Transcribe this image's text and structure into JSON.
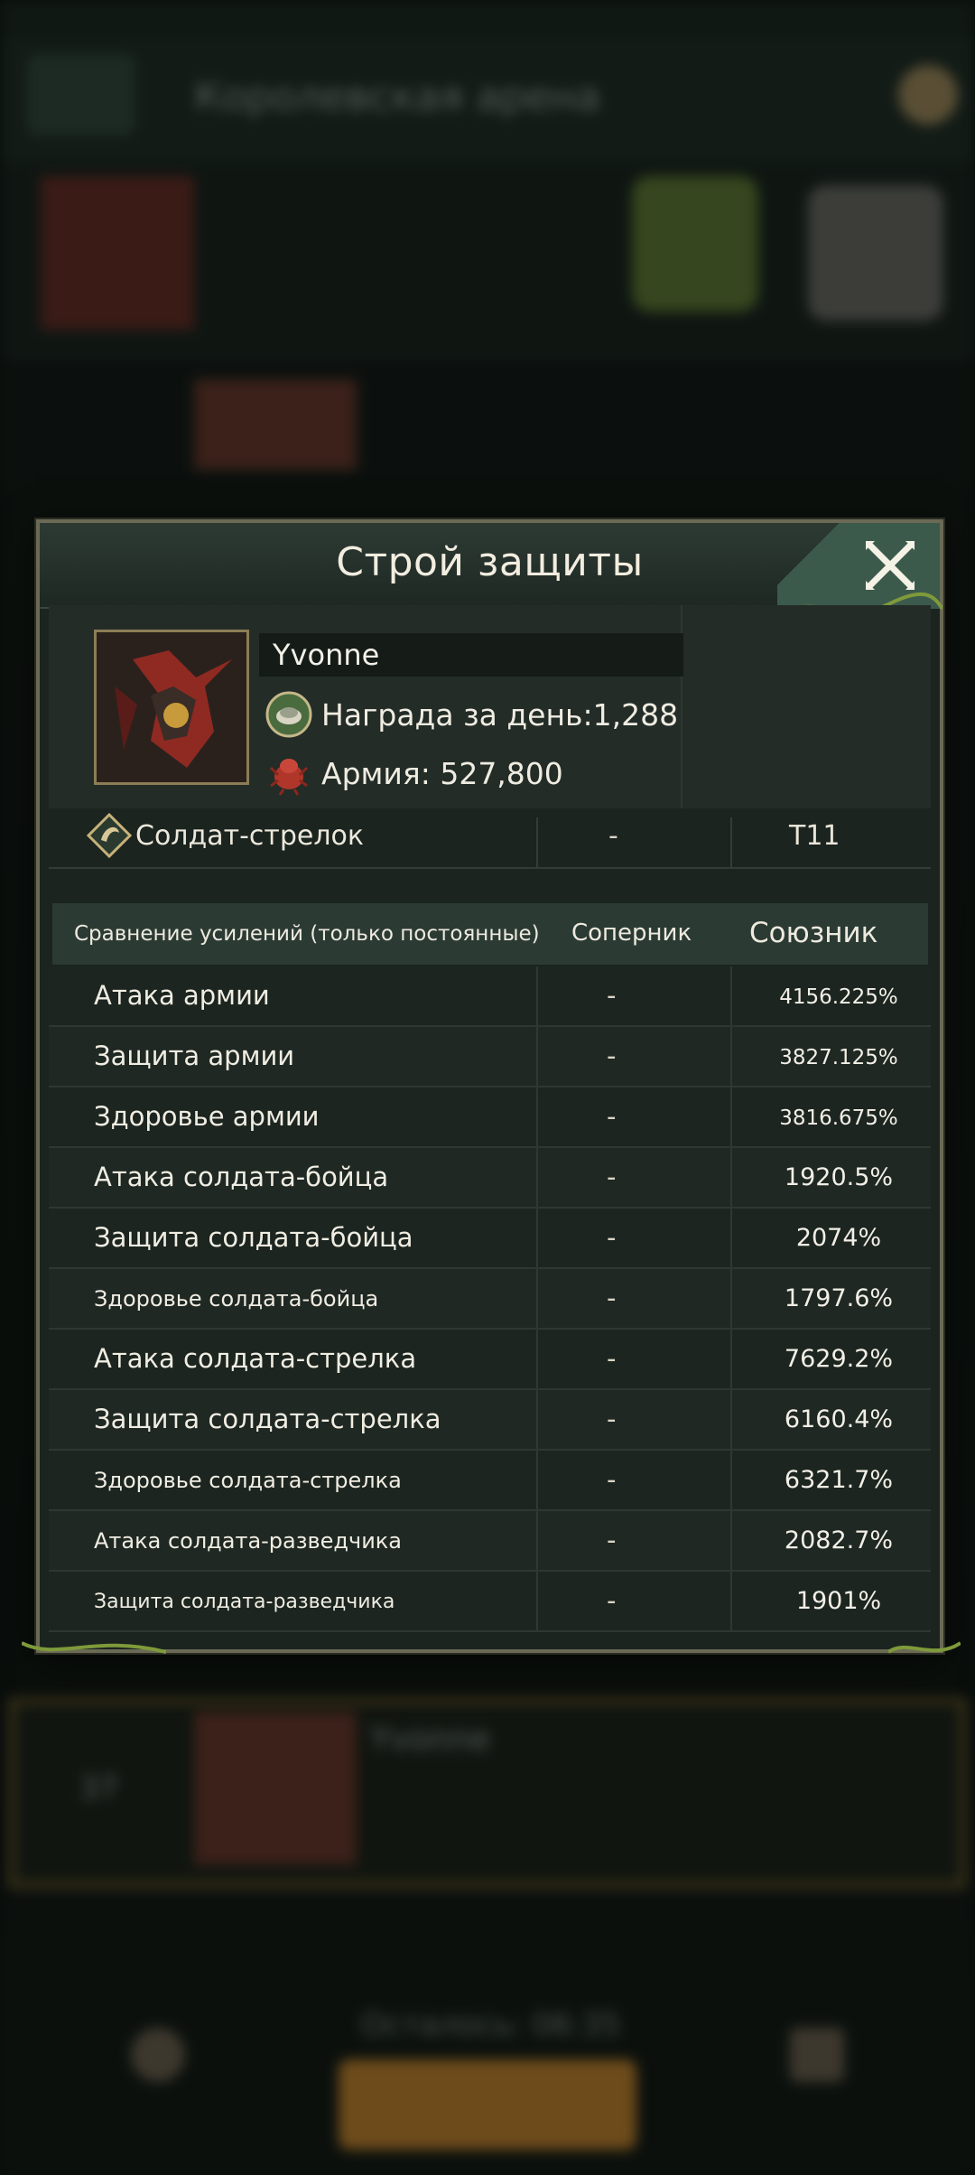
{
  "background": {
    "title": "Королевская арена",
    "timer": "Осталось: 06:35",
    "row_rank": "37",
    "row_name": "Yvonne",
    "colors": {
      "bg": "#0d1410",
      "button": "#a8742a"
    }
  },
  "dialog": {
    "title": "Строй защиты",
    "close_icon": "close-x-icon",
    "profile": {
      "name": "Yvonne",
      "reward_label": "Награда за день:1,288",
      "army_label": "Армия: 527,800"
    },
    "soldier": {
      "type_label": "Солдат-стрелок",
      "rival_value": "-",
      "ally_tier": "T11"
    },
    "table": {
      "headers": {
        "name": "Сравнение усилений (только постоянные)",
        "rival": "Соперник",
        "ally": "Союзник"
      },
      "rows": [
        {
          "name": "Атака армии",
          "rival": "-",
          "ally": "4156.225%"
        },
        {
          "name": "Защита армии",
          "rival": "-",
          "ally": "3827.125%"
        },
        {
          "name": "Здоровье армии",
          "rival": "-",
          "ally": "3816.675%"
        },
        {
          "name": "Атака солдата-бойца",
          "rival": "-",
          "ally": "1920.5%"
        },
        {
          "name": "Защита солдата-бойца",
          "rival": "-",
          "ally": "2074%"
        },
        {
          "name": "Здоровье солдата-бойца",
          "rival": "-",
          "ally": "1797.6%"
        },
        {
          "name": "Атака солдата-стрелка",
          "rival": "-",
          "ally": "7629.2%"
        },
        {
          "name": "Защита солдата-стрелка",
          "rival": "-",
          "ally": "6160.4%"
        },
        {
          "name": "Здоровье солдата-стрелка",
          "rival": "-",
          "ally": "6321.7%"
        },
        {
          "name": "Атака солдата-разведчика",
          "rival": "-",
          "ally": "2082.7%"
        },
        {
          "name": "Защита солдата-разведчика",
          "rival": "-",
          "ally": "1901%"
        }
      ]
    },
    "colors": {
      "accent": "#3c5a4c",
      "border": "#6b6a55",
      "text": "#f2ede0"
    }
  }
}
